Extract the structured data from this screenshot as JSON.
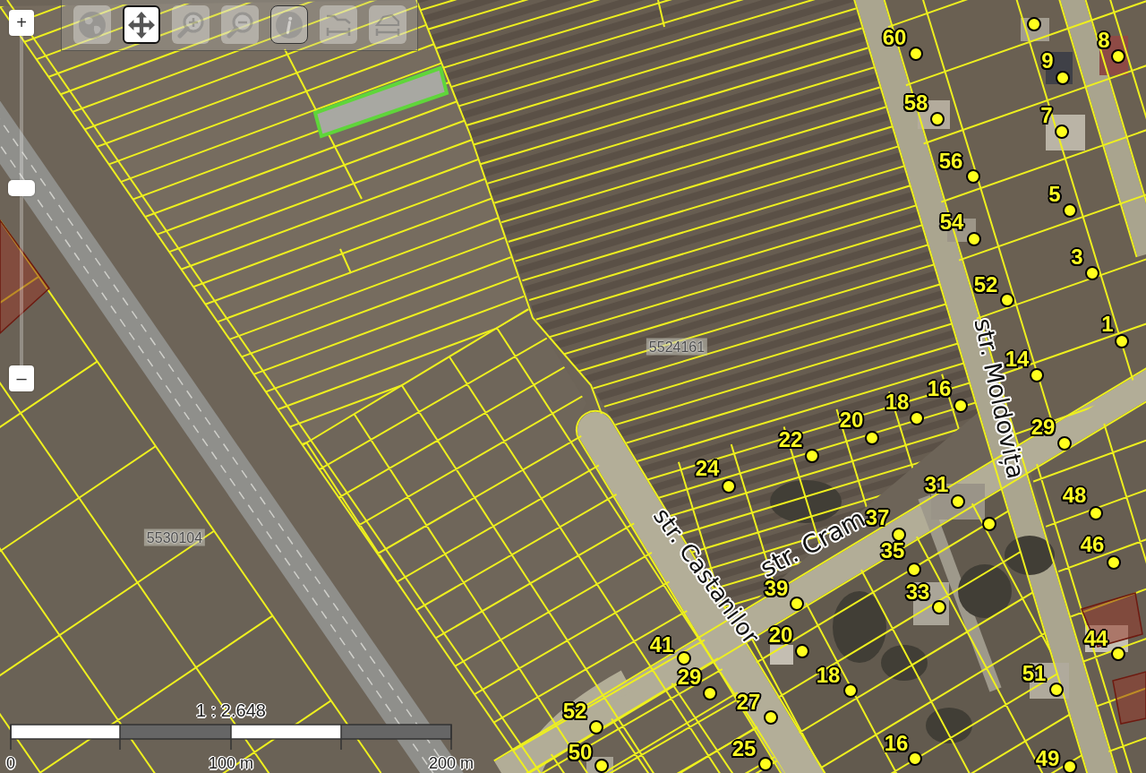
{
  "zoom_control": {
    "zoom_in": "+",
    "slider": {
      "level": 0.54
    },
    "zoom_out": "–"
  },
  "toolbar": {
    "tools": [
      {
        "kind": "globe",
        "selected": false,
        "focused": false
      },
      {
        "kind": "pan",
        "selected": true,
        "focused": false
      },
      {
        "kind": "zoom_in",
        "selected": false,
        "focused": false
      },
      {
        "kind": "zoom_out",
        "selected": false,
        "focused": false
      },
      {
        "kind": "info",
        "selected": false,
        "focused": true
      },
      {
        "kind": "measure_line",
        "selected": false,
        "focused": false
      },
      {
        "kind": "measure_area",
        "selected": false,
        "focused": false
      }
    ]
  },
  "map": {
    "highlighted_parcel": {
      "selected": true
    },
    "parcel_ids": [
      "5524161",
      "5530104"
    ],
    "streets": [
      {
        "name": "str. Moldovița"
      },
      {
        "name": "str. Castanilor"
      },
      {
        "name": "str. Cram"
      }
    ],
    "address_points": [
      {
        "number": "60"
      },
      {
        "number": "8"
      },
      {
        "number": "9"
      },
      {
        "number": "58"
      },
      {
        "number": "7"
      },
      {
        "number": "56"
      },
      {
        "number": "5"
      },
      {
        "number": "54"
      },
      {
        "number": "3"
      },
      {
        "number": "52"
      },
      {
        "number": "1"
      },
      {
        "number": "14"
      },
      {
        "number": "16"
      },
      {
        "number": "18"
      },
      {
        "number": "20"
      },
      {
        "number": "29"
      },
      {
        "number": "22"
      },
      {
        "number": "24"
      },
      {
        "number": "31"
      },
      {
        "number": "48"
      },
      {
        "number": "37"
      },
      {
        "number": "35"
      },
      {
        "number": "46"
      },
      {
        "number": "39"
      },
      {
        "number": "33"
      },
      {
        "number": "41"
      },
      {
        "number": "20"
      },
      {
        "number": "44"
      },
      {
        "number": "29"
      },
      {
        "number": "18"
      },
      {
        "number": "51"
      },
      {
        "number": "52"
      },
      {
        "number": "27"
      },
      {
        "number": "50"
      },
      {
        "number": "25"
      },
      {
        "number": "16"
      },
      {
        "number": "49"
      }
    ]
  },
  "scale_bar": {
    "ratio": "1 : 2.648",
    "labels": [
      "0",
      "100 m",
      "200 m"
    ]
  }
}
